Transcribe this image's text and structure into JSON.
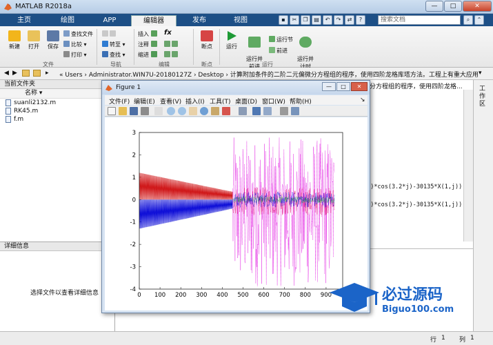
{
  "window": {
    "title": "MATLAB R2018a",
    "controls": [
      "—",
      "□",
      "✕"
    ]
  },
  "ribbon_tabs": [
    "主页",
    "绘图",
    "APP",
    "编辑器",
    "发布",
    "视图"
  ],
  "search_placeholder": "搜索文档",
  "ribbon": {
    "file_group": {
      "label": "文件",
      "new": "新建",
      "open": "打开",
      "save": "保存",
      "find_files": "查找文件",
      "compare": "比较",
      "print": "打印"
    },
    "navigate_group": {
      "label": "导航",
      "goto": "转至",
      "find": "查找"
    },
    "edit_group": {
      "label": "编辑",
      "insert": "插入",
      "comment": "注释",
      "indent": "缩进",
      "fx": "fx"
    },
    "breakpoints_group": {
      "label": "断点",
      "breakpoints": "断点"
    },
    "run_group": {
      "label": "运行",
      "run": "运行",
      "run_advance": "运行并\n前进",
      "run_section": "运行节",
      "advance": "前进",
      "run_time": "运行并\n计时"
    }
  },
  "address_bar": {
    "path": "« Users › Administrator.WIN7U-20180127Z › Desktop › 计算附加条件的二阶二元偏微分方程组的程序，使用四阶龙格库塔方法。工程上有重大应用",
    "path_tail": "分方程组的程序，使用四阶龙格..."
  },
  "current_folder": {
    "title": "当前文件夹",
    "column_name": "名称",
    "files": [
      "suanli2132.m",
      "RK45.m",
      "f.m"
    ]
  },
  "details": {
    "title": "详细信息",
    "message": "选择文件以查看详细信息"
  },
  "side_strip_label": "工作区",
  "code_lines": [
    "03)*cos(3.2*j)-30135*X(1,j))",
    "03)*cos(3.2*j)-30135*X(1,j))"
  ],
  "status_bar": {
    "row_label": "行",
    "row_value": "1",
    "col_label": "列",
    "col_value": "1"
  },
  "figure": {
    "title": "Figure 1",
    "menu": [
      "文件(F)",
      "编辑(E)",
      "查看(V)",
      "插入(I)",
      "工具(T)",
      "桌面(D)",
      "窗口(W)",
      "帮助(H)"
    ]
  },
  "logo": {
    "text": "必过源码",
    "url_text": "Biguo100.com"
  },
  "chart_data": {
    "type": "line",
    "title": "",
    "xlabel": "",
    "ylabel": "",
    "xlim": [
      0,
      980
    ],
    "ylim": [
      -4,
      3
    ],
    "xticks": [
      0,
      100,
      200,
      300,
      400,
      500,
      600,
      700,
      800,
      900
    ],
    "yticks": [
      3,
      2,
      1,
      0,
      -1,
      -2,
      -3,
      -4
    ],
    "grid": false,
    "series": [
      {
        "color": "#d0191b",
        "x_range": [
          0,
          450
        ],
        "y_start": [
          0,
          1.2
        ],
        "y_end": [
          0,
          0.35
        ],
        "style": "dense oscillation"
      },
      {
        "color": "#1010d8",
        "x_range": [
          0,
          450
        ],
        "y_start": [
          -1.3,
          0
        ],
        "y_end": [
          -0.4,
          0
        ],
        "style": "dense oscillation"
      },
      {
        "color": "#e010e0",
        "x_range": [
          450,
          940
        ],
        "y_range": [
          -3.9,
          2.8
        ],
        "style": "dense noise"
      },
      {
        "color": "#e0106a",
        "x_range": [
          450,
          940
        ],
        "y_range": [
          -0.7,
          0.55
        ],
        "style": "dense noise"
      },
      {
        "color": "#10b030",
        "x_range": [
          450,
          940
        ],
        "y_range": [
          -0.15,
          0.15
        ],
        "style": "dense noise"
      },
      {
        "color": "#1010d8",
        "x_range": [
          450,
          940
        ],
        "y_range": [
          -0.35,
          0.35
        ],
        "style": "dense noise"
      }
    ]
  }
}
